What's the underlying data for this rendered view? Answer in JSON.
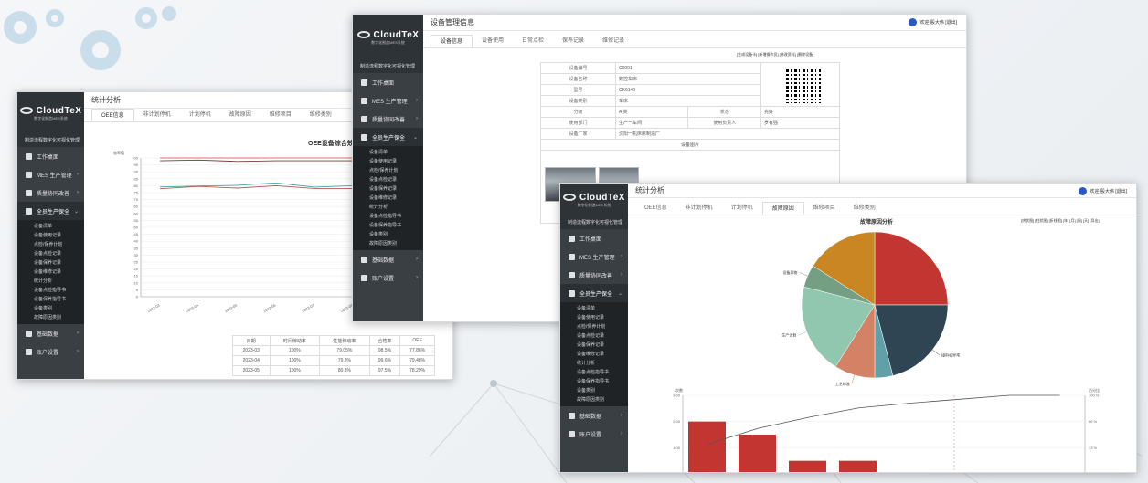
{
  "brand": {
    "name": "CloudTeX",
    "tagline": "数字化制造MES系统",
    "system_title": "制造流程数字化可视化管理"
  },
  "menu": [
    {
      "label": "工作桌面"
    },
    {
      "label": "MES 生产管理"
    },
    {
      "label": "质量协同改善"
    },
    {
      "label": "全员生产保全"
    },
    {
      "label": "基础数据"
    },
    {
      "label": "账户设置"
    }
  ],
  "submenu": [
    "设备清单",
    "设备使用记录",
    "点检/保养计划",
    "设备点检记录",
    "设备保养记录",
    "设备维修记录",
    "统计分析",
    "设备点检指导书",
    "设备保养指导书",
    "设备类别",
    "故障原因类别"
  ],
  "user": {
    "greeting": "欢迎 殷大伟 [退出]"
  },
  "win1": {
    "title": "统计分析",
    "tabs": [
      "OEE信息",
      "非计划停机",
      "计划停机",
      "故障原因",
      "维修项目",
      "维修类别"
    ],
    "chart_title": "OEE设备综合效率分",
    "y_unit": "效率值",
    "y_ticks": [
      "100",
      "95",
      "90",
      "85",
      "80",
      "75",
      "70",
      "65",
      "60",
      "55",
      "50",
      "45",
      "40",
      "35",
      "30",
      "25",
      "20",
      "15",
      "10",
      "5",
      "0"
    ],
    "x_ticks": [
      "2023-03",
      "2023-04",
      "2023-05",
      "2023-06",
      "2023-07",
      "2023-08",
      "2023-09",
      "2023-10"
    ],
    "table": {
      "headers": [
        "日期",
        "时间稼动率",
        "性能稼动率",
        "合格率",
        "OEE"
      ],
      "rows": [
        [
          "2023-03",
          "100%",
          "79.05%",
          "98.5%",
          "77.86%"
        ],
        [
          "2023-04",
          "100%",
          "79.8%",
          "99.6%",
          "79.48%"
        ],
        [
          "2023-05",
          "100%",
          "80.3%",
          "97.5%",
          "78.29%"
        ]
      ]
    }
  },
  "win2": {
    "title": "设备管理信息",
    "tabs": [
      "设备信息",
      "设备使用",
      "日常点检",
      "保养记录",
      "维修记录"
    ],
    "actions": "[生成设备卡] [新增操作员] [修改资料] [删除设备]",
    "fields": {
      "code_label": "设备编号",
      "code": "C0001",
      "name_label": "设备名称",
      "name": "数控车床",
      "model_label": "型号",
      "model": "CK6140",
      "cat_label": "设备类别",
      "cat": "车床",
      "grade_label": "分级",
      "grade": "A 类",
      "status_label": "状态",
      "status": "完好",
      "dept_label": "使用部门",
      "dept": "生产一车间",
      "owner_label": "使用负责人",
      "owner": "罗有强",
      "maker_label": "设备厂家",
      "maker": "沈阳一机床床制造厂",
      "photo_label": "设备图片"
    }
  },
  "win3": {
    "title": "统计分析",
    "tabs": [
      "OEE信息",
      "非计划停机",
      "计划停机",
      "故障原因",
      "维修项目",
      "维修类别"
    ],
    "chart_title": "故障原因分析",
    "legend": "[饼状图] [柱状图] [折线图] [年] [月] [周] [天] [导出]",
    "pareto_left_unit": "次数",
    "pareto_right_unit": "百分比",
    "left_ticks": [
      "3.00",
      "2.00",
      "1.00"
    ],
    "right_ticks": [
      "100 %",
      "66 %",
      "33 %"
    ]
  },
  "chart_data": [
    {
      "type": "line",
      "title": "OEE设备综合效率分",
      "ylabel": "效率值",
      "ylim": [
        0,
        100
      ],
      "x": [
        "2023-03",
        "2023-04",
        "2023-05",
        "2023-06",
        "2023-07",
        "2023-08",
        "2023-09",
        "2023-10"
      ],
      "series": [
        {
          "values": [
            100,
            100,
            100,
            100,
            100,
            100,
            100,
            100
          ],
          "color": "#e56a6a"
        },
        {
          "values": [
            98,
            98.5,
            97.5,
            98,
            98,
            98,
            99,
            99
          ],
          "color": "#7a3a3a"
        },
        {
          "values": [
            79.05,
            79.8,
            80.3,
            82,
            79,
            80,
            80,
            80
          ],
          "color": "#4aa3a3"
        },
        {
          "values": [
            77.86,
            79.48,
            78.29,
            80,
            78,
            78,
            79,
            79
          ],
          "color": "#b35a5a"
        }
      ]
    },
    {
      "type": "pie",
      "title": "故障原因分析",
      "slices": [
        {
          "label": "",
          "value": 25,
          "color": "#c23531"
        },
        {
          "label": "接料机异常",
          "value": 21,
          "color": "#2f4554"
        },
        {
          "label": "",
          "value": 4,
          "color": "#61a0a8"
        },
        {
          "label": "工艺标准",
          "value": 9,
          "color": "#d48265"
        },
        {
          "label": "生产计划",
          "value": 20,
          "color": "#91c7ae"
        },
        {
          "label": "设备异物",
          "value": 5,
          "color": "#749f83"
        },
        {
          "label": "",
          "value": 16,
          "color": "#ca8622"
        }
      ]
    },
    {
      "type": "bar",
      "title": "",
      "ylabel": "次数",
      "ylim": [
        0,
        3
      ],
      "values": [
        2,
        1.5,
        0.5,
        0.5,
        0,
        0,
        0,
        0
      ],
      "cumulative_percent": [
        38,
        58,
        72,
        84,
        90,
        95,
        100,
        100
      ],
      "color": "#c23531"
    }
  ]
}
